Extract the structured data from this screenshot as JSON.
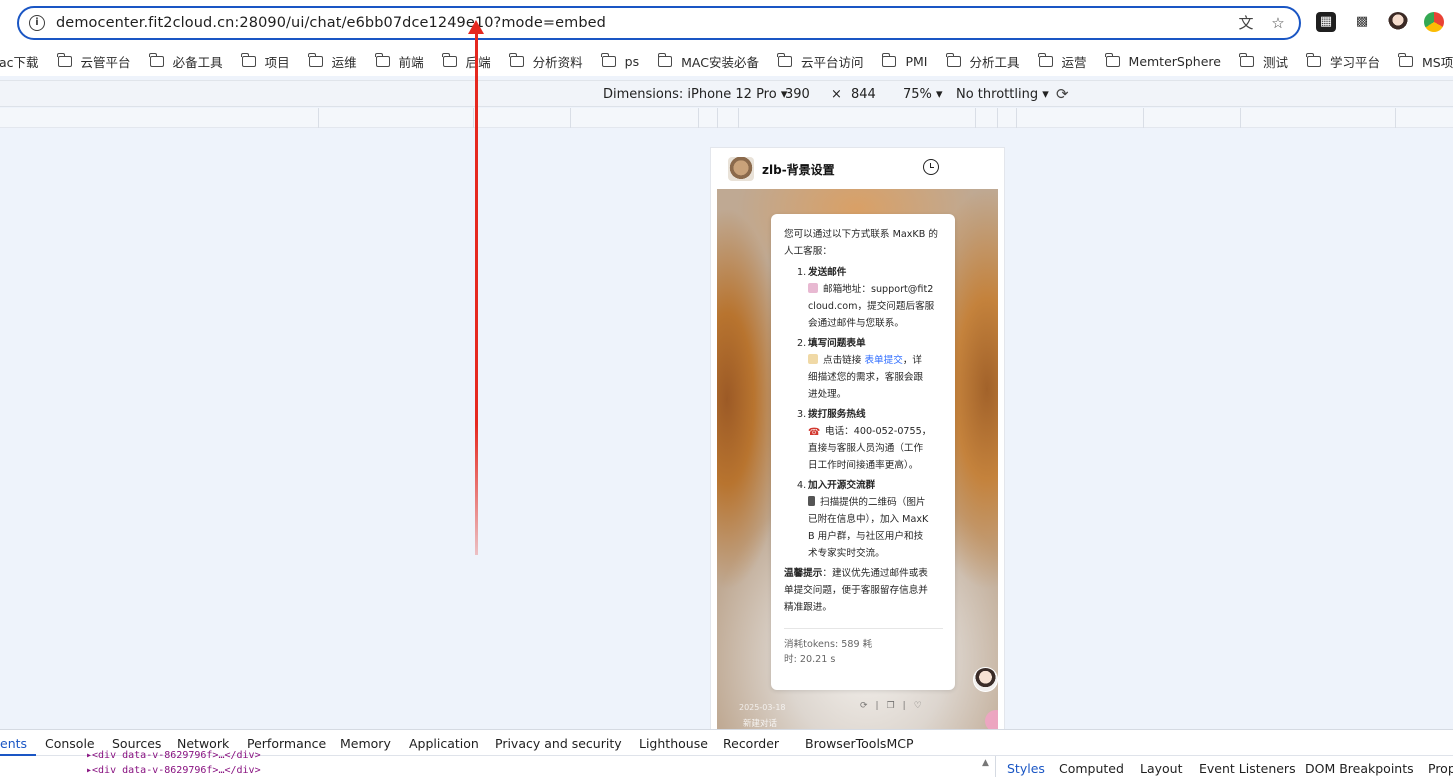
{
  "browser": {
    "url": "democenter.fit2cloud.cn:28090/ui/chat/e6bb07dce1249e10?mode=embed",
    "info_icon": "i",
    "actions": [
      "translate-icon",
      "star-icon"
    ],
    "extensions": [
      "extension-icon",
      "qr-icon",
      "avatar-icon",
      "chrome-icon"
    ]
  },
  "bookmarks": [
    {
      "label": "ac下载",
      "folder": false
    },
    {
      "label": "云管平台",
      "folder": true
    },
    {
      "label": "必备工具",
      "folder": true
    },
    {
      "label": "项目",
      "folder": true
    },
    {
      "label": "运维",
      "folder": true
    },
    {
      "label": "前端",
      "folder": true
    },
    {
      "label": "后端",
      "folder": true
    },
    {
      "label": "分析资料",
      "folder": true
    },
    {
      "label": "ps",
      "folder": true
    },
    {
      "label": "MAC安装必备",
      "folder": true
    },
    {
      "label": "云平台访问",
      "folder": true
    },
    {
      "label": "PMI",
      "folder": true
    },
    {
      "label": "分析工具",
      "folder": true
    },
    {
      "label": "运营",
      "folder": true
    },
    {
      "label": "MemterSphere",
      "folder": true
    },
    {
      "label": "测试",
      "folder": true
    },
    {
      "label": "学习平台",
      "folder": true
    },
    {
      "label": "MS项目",
      "folder": true
    }
  ],
  "device_toolbar": {
    "dimensions": "Dimensions: iPhone 12 Pro ▾",
    "width": "390",
    "times": "×",
    "height": "844",
    "zoom": "75% ▾",
    "throttling": "No throttling ▾"
  },
  "chat": {
    "title": "zlb-背景设置",
    "intro": "您可以通过以下方式联系 MaxKB 的人工客服：",
    "items": [
      {
        "num": "1.",
        "heading": "发送邮件",
        "lines": [
          "邮箱地址：support@fit2",
          "cloud.com，提交问题后客服",
          "会通过邮件与您联系。"
        ]
      },
      {
        "num": "2.",
        "heading": "填写问题表单",
        "line1_prefix": "点击链接 ",
        "line1_link": "表单提交",
        "line1_suffix": "，详",
        "lines": [
          "细描述您的需求，客服会跟",
          "进处理。"
        ]
      },
      {
        "num": "3.",
        "heading": "拨打服务热线",
        "lines": [
          "电话：400-052-0755，",
          "直接与客服人员沟通（工作",
          "日工作时间接通率更高）。"
        ]
      },
      {
        "num": "4.",
        "heading": "加入开源交流群",
        "lines": [
          "扫描提供的二维码（图片",
          "已附在信息中），加入 MaxK",
          "B 用户群，与社区用户和技",
          "术专家实时交流。"
        ]
      }
    ],
    "tip_label": "温馨提示",
    "tip_lines": [
      "：建议优先通过邮件或表",
      "单提交问题，便于客服留存信息并",
      "精准跟进。"
    ],
    "meta_line1": "消耗tokens: 589  耗",
    "meta_line2": "时: 20.21 s",
    "faded_time": "2025-03-18",
    "new_chat": "新建对话"
  },
  "devtools": {
    "tabs": [
      "ents",
      "Console",
      "Sources",
      "Network",
      "Performance",
      "Memory",
      "Application",
      "Privacy and security",
      "Lighthouse",
      "Recorder",
      "BrowserToolsMCP"
    ],
    "dom_line1": "▸<div data-v-8629796f>…</div>",
    "dom_line2": "▸<div data-v-8629796f>…</div>",
    "side_tabs": [
      "Styles",
      "Computed",
      "Layout",
      "Event Listeners",
      "DOM Breakpoints",
      "Prop"
    ]
  },
  "colors": {
    "accent": "#1a56c4",
    "arrow": "#e5281f",
    "link": "#3370ff"
  }
}
